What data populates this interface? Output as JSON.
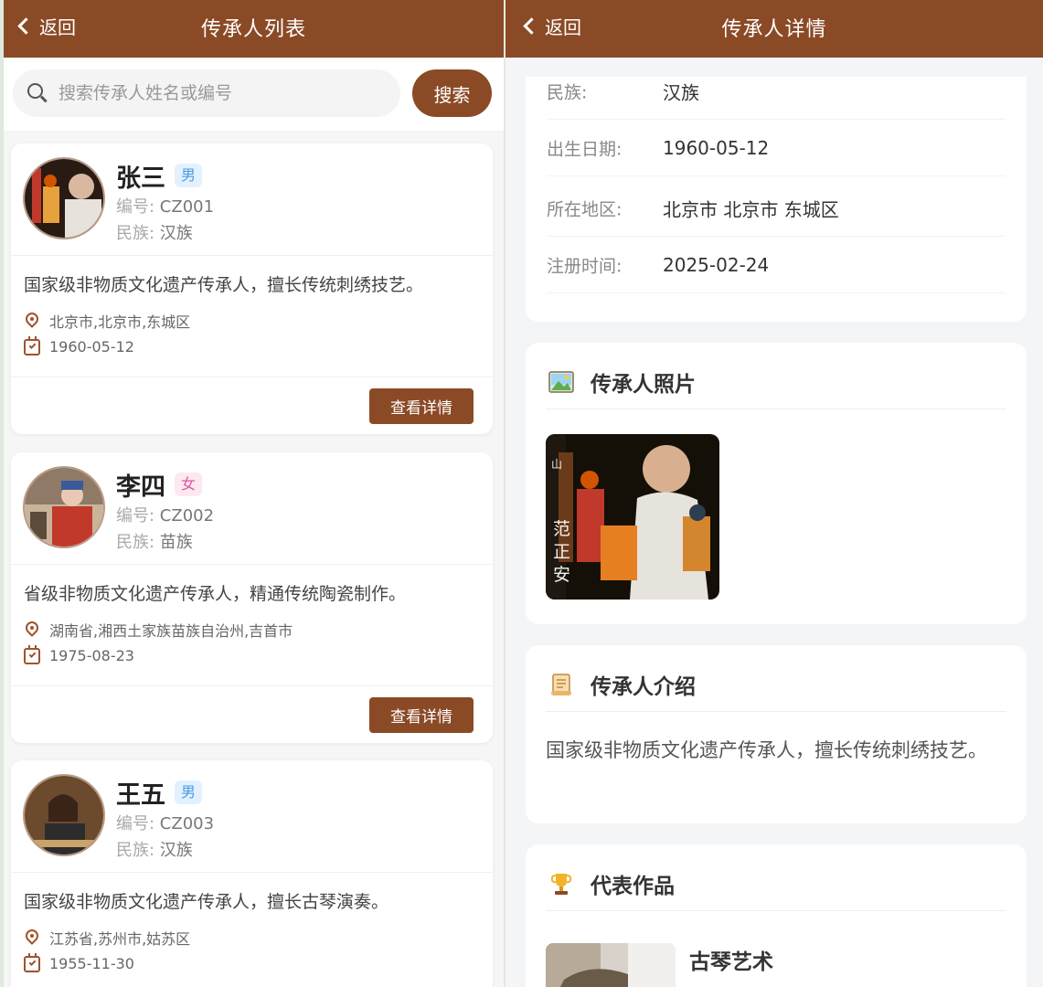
{
  "left": {
    "nav": {
      "back": "返回",
      "title": "传承人列表"
    },
    "search": {
      "placeholder": "搜索传承人姓名或编号",
      "button": "搜索"
    },
    "labels": {
      "code": "编号: ",
      "nation": "民族: "
    },
    "detail_button": "查看详情",
    "inheritors": [
      {
        "name": "张三",
        "gender": "男",
        "code": "CZ001",
        "nation": "汉族",
        "desc": "国家级非物质文化遗产传承人，擅长传统刺绣技艺。",
        "region": "北京市,北京市,东城区",
        "birth": "1960-05-12"
      },
      {
        "name": "李四",
        "gender": "女",
        "code": "CZ002",
        "nation": "苗族",
        "desc": "省级非物质文化遗产传承人，精通传统陶瓷制作。",
        "region": "湖南省,湘西土家族苗族自治州,吉首市",
        "birth": "1975-08-23"
      },
      {
        "name": "王五",
        "gender": "男",
        "code": "CZ003",
        "nation": "汉族",
        "desc": "国家级非物质文化遗产传承人，擅长古琴演奏。",
        "region": "江苏省,苏州市,姑苏区",
        "birth": "1955-11-30"
      }
    ]
  },
  "right": {
    "nav": {
      "back": "返回",
      "title": "传承人详情"
    },
    "info": [
      {
        "label": "民族:",
        "value": "汉族"
      },
      {
        "label": "出生日期:",
        "value": "1960-05-12"
      },
      {
        "label": "所在地区:",
        "value": "北京市 北京市 东城区"
      },
      {
        "label": "注册时间:",
        "value": "2025-02-24"
      }
    ],
    "photo_section": {
      "icon": "picture-icon",
      "title": "传承人照片"
    },
    "photo_overlay": {
      "top": "山",
      "vertical": "范正安"
    },
    "intro_section": {
      "icon": "scroll-icon",
      "title": "传承人介绍",
      "text": "国家级非物质文化遗产传承人，擅长传统刺绣技艺。"
    },
    "works_section": {
      "icon": "trophy-icon",
      "title": "代表作品",
      "work_title": "古琴艺术"
    }
  },
  "colors": {
    "brand": "#8b4a26",
    "male_badge": "#4a9ae0",
    "female_badge": "#e0569a"
  }
}
